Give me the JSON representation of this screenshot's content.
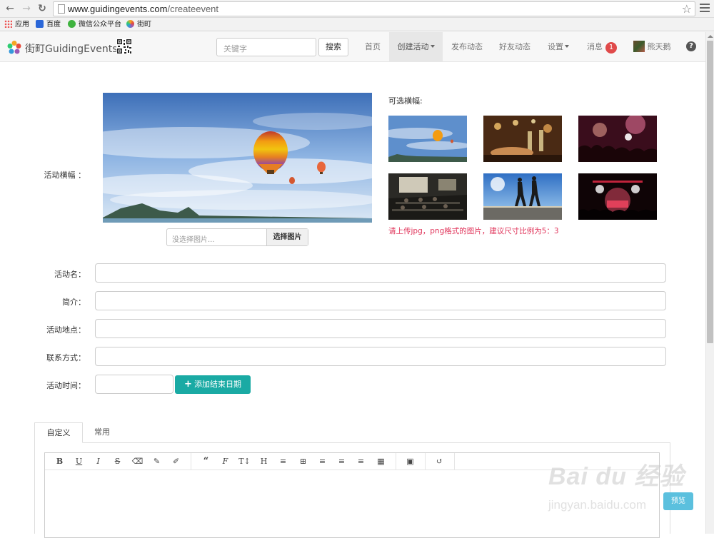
{
  "browser": {
    "url_host": "www.guidingevents.com",
    "url_path": "/createevent",
    "bookmarks": [
      "应用",
      "百度",
      "微信公众平台",
      "街町"
    ]
  },
  "navbar": {
    "logo_text": "街町GuidingEvents",
    "search_placeholder": "关键字",
    "search_button": "搜索",
    "items": [
      {
        "label": "首页"
      },
      {
        "label": "创建活动",
        "active": true,
        "dropdown": true
      },
      {
        "label": "发布动态"
      },
      {
        "label": "好友动态"
      },
      {
        "label": "设置",
        "dropdown": true
      },
      {
        "label": "消息",
        "badge": "1"
      },
      {
        "label": "熊天鹅"
      }
    ],
    "help_icon": "question-circle-icon"
  },
  "form": {
    "banner_label": "活动横幅 ：",
    "file_placeholder": "没选择图片...",
    "file_button": "选择图片",
    "optional_title": "可选横幅:",
    "hint": "请上传jpg，png格式的图片，建议尺寸比例为5：3",
    "name_label": "活动名：",
    "intro_label": "简介：",
    "location_label": "活动地点：",
    "contact_label": "联系方式：",
    "time_label": "活动时间：",
    "add_end_date_button": "添加结束日期"
  },
  "editor": {
    "tabs": [
      "自定义",
      "常用"
    ],
    "toolbar": [
      "B",
      "U",
      "I",
      "S",
      "eraser-icon",
      "pencil-icon",
      "brush-icon",
      "quote-icon",
      "font-icon",
      "text-size-icon",
      "H",
      "list-icon",
      "ordered-list-icon",
      "align-left-icon",
      "align-center-icon",
      "align-right-icon",
      "table-icon",
      "image-icon",
      "undo-icon"
    ],
    "preview_button": "预览"
  },
  "watermark": {
    "main": "Bai du 经验",
    "url": "jingyan.baidu.com"
  },
  "colors": {
    "primary_teal": "#1aaaa4",
    "hint_red": "#e0345a",
    "badge_red": "#e04a4a",
    "preview_blue": "#5bc0de"
  }
}
